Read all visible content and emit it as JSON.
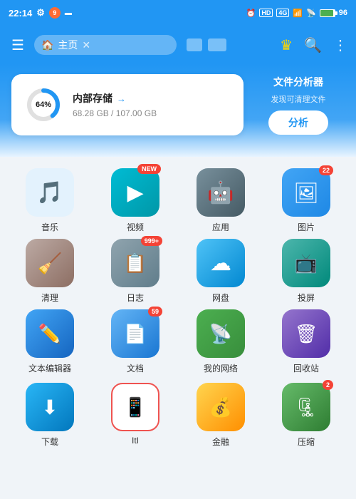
{
  "statusBar": {
    "time": "22:14",
    "batteryPct": "96"
  },
  "header": {
    "tabLabel": "主页",
    "actions": {
      "crown": "👑",
      "search": "🔍",
      "more": "⋮"
    }
  },
  "storageCard": {
    "percent": "64%",
    "title": "内部存储",
    "used": "68.28 GB",
    "total": "107.00 GB",
    "sizeText": "68.28 GB / 107.00 GB"
  },
  "analyzerCard": {
    "title": "文件分析器",
    "subtitle": "发现可清理文件",
    "buttonLabel": "分析"
  },
  "grid": {
    "items": [
      {
        "label": "音乐",
        "badge": null,
        "badgeNew": false
      },
      {
        "label": "视频",
        "badge": null,
        "badgeNew": true
      },
      {
        "label": "应用",
        "badge": null,
        "badgeNew": false
      },
      {
        "label": "图片",
        "badge": "22",
        "badgeNew": false
      },
      {
        "label": "清理",
        "badge": null,
        "badgeNew": false
      },
      {
        "label": "日志",
        "badge": "999+",
        "badgeNew": false
      },
      {
        "label": "网盘",
        "badge": null,
        "badgeNew": false
      },
      {
        "label": "投屏",
        "badge": null,
        "badgeNew": false
      },
      {
        "label": "文本编辑器",
        "badge": null,
        "badgeNew": false
      },
      {
        "label": "文档",
        "badge": "59",
        "badgeNew": false
      },
      {
        "label": "我的网络",
        "badge": null,
        "badgeNew": false
      },
      {
        "label": "回收站",
        "badge": null,
        "badgeNew": false
      },
      {
        "label": "下载",
        "badge": null,
        "badgeNew": false
      },
      {
        "label": "ItI",
        "badge": null,
        "badgeNew": false,
        "highlighted": true
      },
      {
        "label": "金融",
        "badge": null,
        "badgeNew": false
      },
      {
        "label": "压缩",
        "badge": "2",
        "badgeNew": false
      }
    ]
  }
}
